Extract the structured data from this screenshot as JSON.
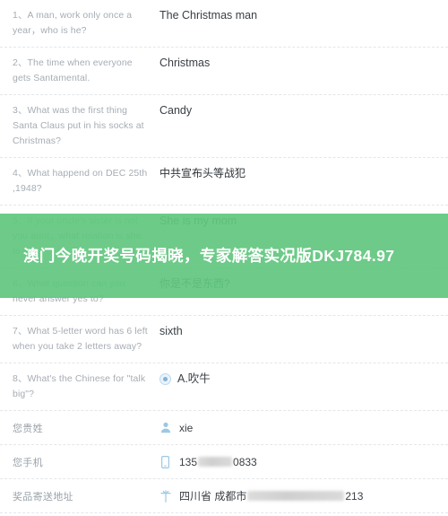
{
  "survey": {
    "rows": [
      {
        "number": "1、",
        "question": "A man, work only once a year，who is he?",
        "answer": "The Christmas man",
        "answer_type": "text"
      },
      {
        "number": "2、",
        "question": "The time when everyone gets Santamental.",
        "answer": "Christmas",
        "answer_type": "text"
      },
      {
        "number": "3、",
        "question": "What was the first thing Santa Claus put in his socks at Christmas?",
        "answer": "Candy",
        "answer_type": "text"
      },
      {
        "number": "4、",
        "question": "What happend on DEC 25th ,1948?",
        "answer": "中共宣布头等战犯",
        "answer_type": "cjk"
      },
      {
        "number": "5、",
        "question": "If your uncle's sister is not you aunt，what relation is she to you?",
        "answer": "She is my mom",
        "answer_type": "text"
      },
      {
        "number": "6、",
        "question": "What question can you never answer yes to?",
        "answer": "你是不是东西?",
        "answer_type": "cjk"
      },
      {
        "number": "7、",
        "question": "What 5-letter word has 6 left when you take 2 letters away?",
        "answer": "sixth",
        "answer_type": "text"
      },
      {
        "number": "8、",
        "question": "What's the Chinese for \"talk big\"?",
        "answer": "A.吹牛",
        "answer_type": "radio"
      }
    ]
  },
  "contact": {
    "rows": [
      {
        "label": "您贵姓",
        "icon": "user-icon",
        "value": "xie",
        "redacted": false
      },
      {
        "label": "您手机",
        "icon": "phone-icon",
        "value_prefix": "135",
        "value_suffix": "0833",
        "redacted": true
      },
      {
        "label": "奖品寄送地址",
        "icon": "location-pin-icon",
        "value_prefix": "四川省 成都市",
        "value_suffix": "213",
        "redacted": true
      }
    ]
  },
  "promo_overlay": {
    "text": "澳门今晚开奖号码揭晓，专家解答实况版DKJ784.97",
    "background_color": "#62c77f",
    "text_color": "#ffffff"
  }
}
